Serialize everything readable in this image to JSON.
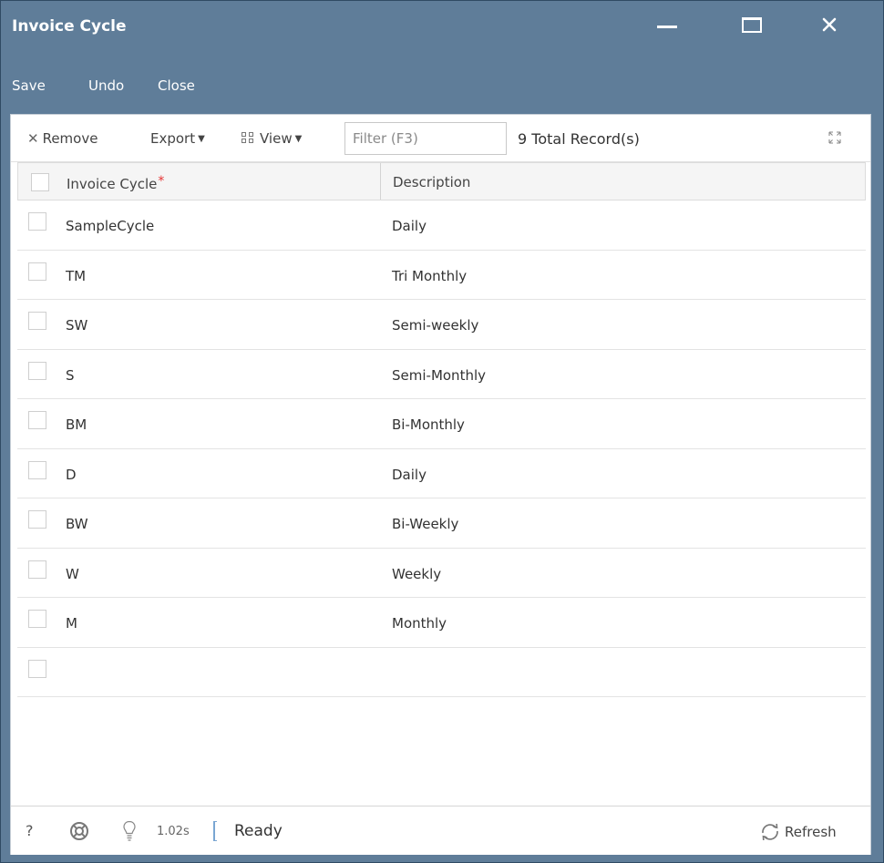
{
  "window": {
    "title": "Invoice Cycle",
    "colors": {
      "titlebar": "#5f7d99",
      "required_marker": "#e53333"
    }
  },
  "actions": {
    "save_label": "Save",
    "undo_label": "Undo",
    "close_label": "Close"
  },
  "toolbar": {
    "remove_label": "Remove",
    "export_label": "Export",
    "view_label": "View",
    "filter_placeholder": "Filter (F3)",
    "records_text": "9 Total Record(s)"
  },
  "grid": {
    "columns": {
      "invoice_cycle": "Invoice Cycle",
      "required_marker": "*",
      "description": "Description"
    },
    "rows": [
      {
        "code": "SampleCycle",
        "description": "Daily"
      },
      {
        "code": "TM",
        "description": "Tri Monthly"
      },
      {
        "code": "SW",
        "description": "Semi-weekly"
      },
      {
        "code": "S",
        "description": "Semi-Monthly"
      },
      {
        "code": "BM",
        "description": "Bi-Monthly"
      },
      {
        "code": "D",
        "description": "Daily"
      },
      {
        "code": "BW",
        "description": "Bi-Weekly"
      },
      {
        "code": "W",
        "description": "Weekly"
      },
      {
        "code": "M",
        "description": "Monthly"
      },
      {
        "code": "",
        "description": ""
      }
    ]
  },
  "statusbar": {
    "help_label": "?",
    "time": "1.02s",
    "status": "Ready",
    "refresh_label": "Refresh"
  }
}
